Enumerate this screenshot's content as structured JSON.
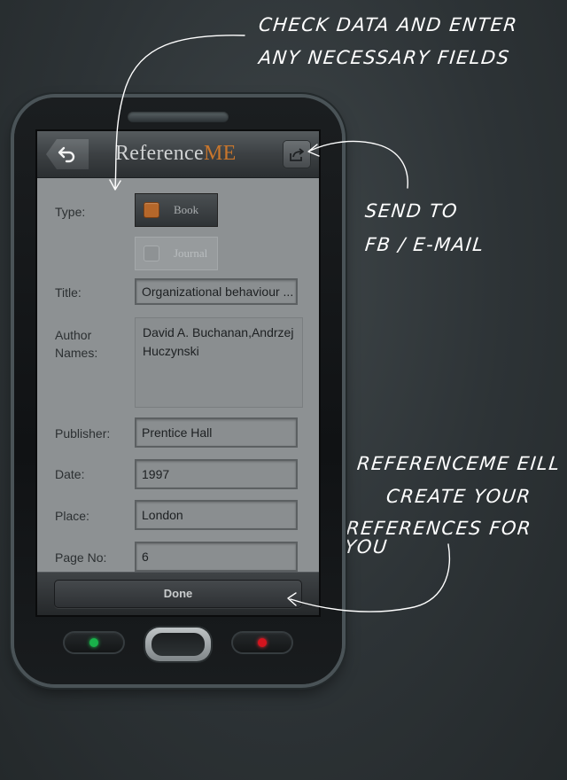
{
  "annotations": {
    "top_line1": "CHECK DATA AND ENTER",
    "top_line2": "ANY NECESSARY FIELDS",
    "send_line1": "SEND TO",
    "send_line2": "FB / E-MAIL",
    "bottom_line1": "REFERENCEME EILL",
    "bottom_line2": "CREATE YOUR",
    "bottom_line3": "REFERENCES FOR YOU"
  },
  "app": {
    "title_main": "Reference",
    "title_accent": "ME",
    "accent_color": "#c8762c"
  },
  "form": {
    "type_label": "Type:",
    "type_options": [
      "Book",
      "Journal"
    ],
    "type_selected": "Book",
    "title_label": "Title:",
    "title_value": "Organizational behaviour ...",
    "author_label_line1": "Author",
    "author_label_line2": "Names:",
    "author_value": "David A. Buchanan,Andrzej Huczynski",
    "publisher_label": "Publisher:",
    "publisher_value": "Prentice Hall",
    "date_label": "Date:",
    "date_value": "1997",
    "place_label": "Place:",
    "place_value": "London",
    "pageno_label": "Page No:",
    "pageno_value": "6"
  },
  "toolbar": {
    "done_label": "Done"
  },
  "icons": {
    "back": "undo-arrow-icon",
    "share": "share-export-icon",
    "call": "green-call-dot",
    "end": "red-end-dot"
  }
}
